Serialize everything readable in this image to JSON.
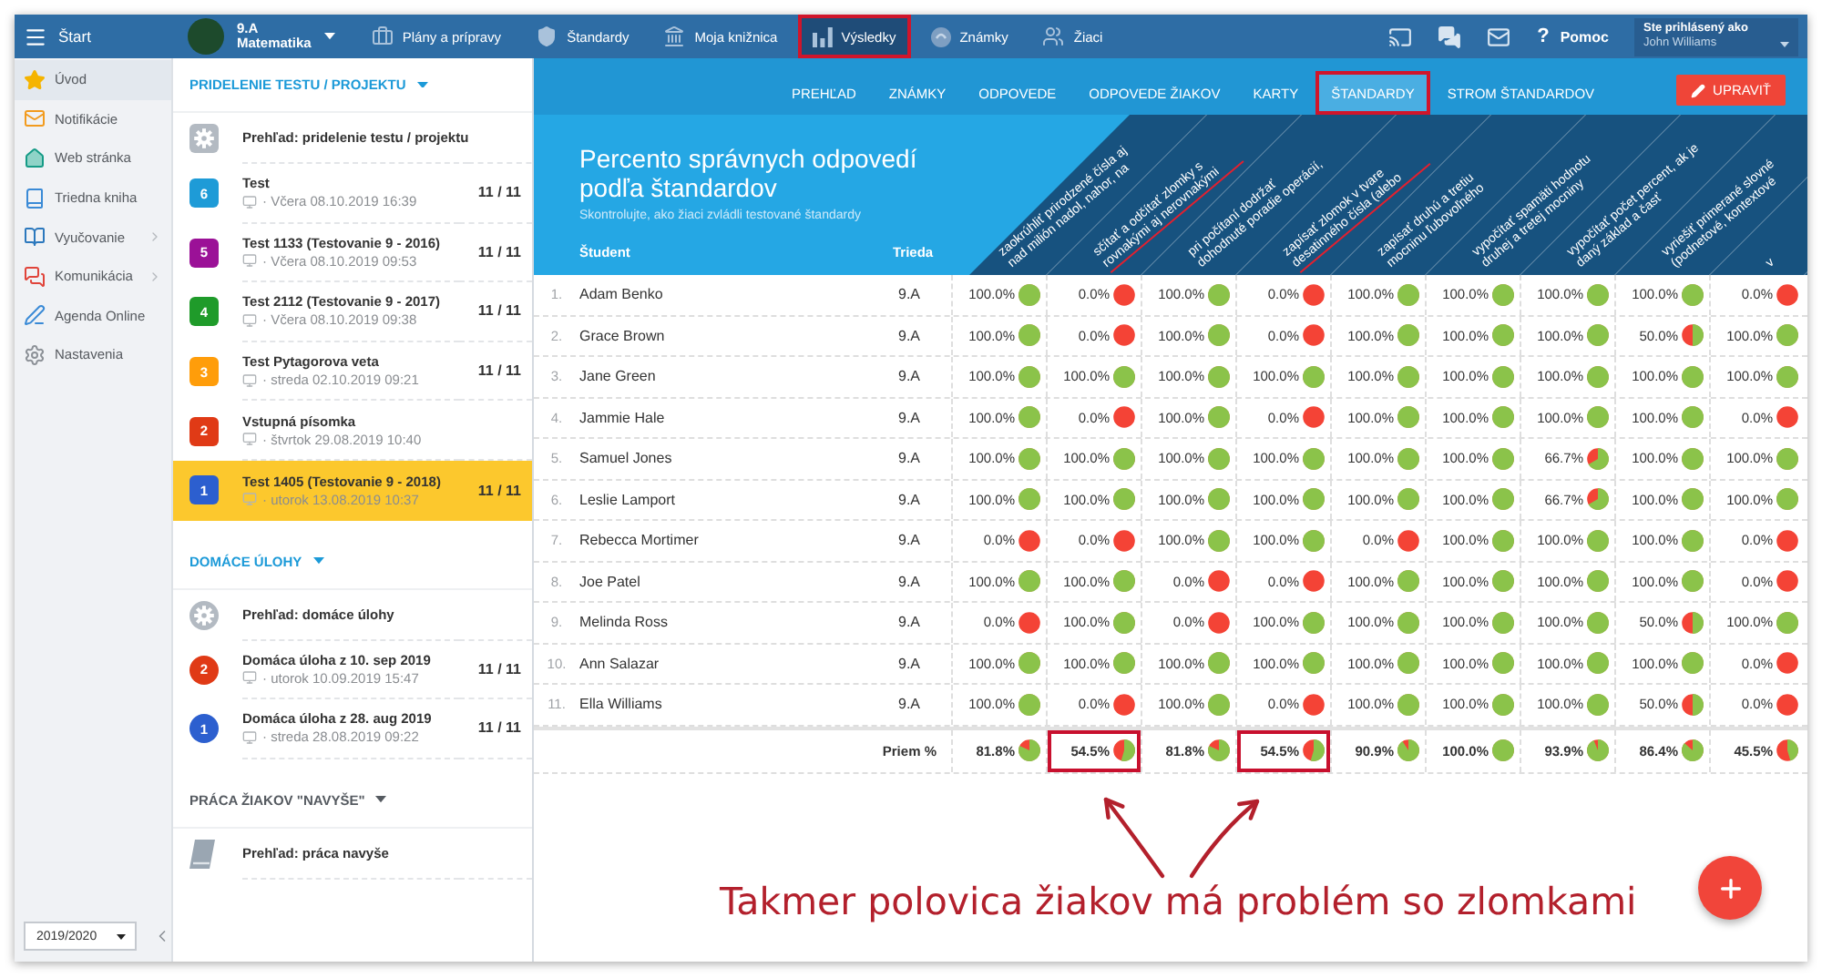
{
  "topbar": {
    "start": "Štart",
    "class_switcher": {
      "class": "9.A",
      "subject": "Matematika"
    },
    "nav": [
      {
        "label": "Plány a prípravy",
        "selected": false,
        "annotated": false
      },
      {
        "label": "Štandardy",
        "selected": false,
        "annotated": false
      },
      {
        "label": "Moja knižnica",
        "selected": false,
        "annotated": false
      },
      {
        "label": "Výsledky",
        "selected": true,
        "annotated": true
      },
      {
        "label": "Známky",
        "selected": false,
        "annotated": false
      },
      {
        "label": "Žiaci",
        "selected": false,
        "annotated": false
      }
    ],
    "help": {
      "glyph": "?",
      "label": "Pomoc"
    },
    "user": {
      "caption": "Ste prihlásený ako",
      "name": "John Williams"
    }
  },
  "sidebar": {
    "items": [
      {
        "label": "Úvod",
        "selected": true,
        "submenu": false
      },
      {
        "label": "Notifikácie",
        "selected": false,
        "submenu": false
      },
      {
        "label": "Web stránka",
        "selected": false,
        "submenu": false
      },
      {
        "label": "Triedna kniha",
        "selected": false,
        "submenu": false
      },
      {
        "label": "Vyučovanie",
        "selected": false,
        "submenu": true
      },
      {
        "label": "Komunikácia",
        "selected": false,
        "submenu": true
      },
      {
        "label": "Agenda Online",
        "selected": false,
        "submenu": false
      },
      {
        "label": "Nastavenia",
        "selected": false,
        "submenu": false
      }
    ],
    "year": "2019/2020"
  },
  "assignments": {
    "sections": [
      {
        "kind": "test",
        "title": "PRIDELENIE TESTU / PROJEKTU",
        "overview": "Prehľad: pridelenie testu / projektu",
        "items": [
          {
            "badge": "6",
            "color": "#1e9bd7",
            "title": "Test",
            "date": "· Včera 08.10.2019 16:39",
            "count": "11 / 11",
            "selected": false
          },
          {
            "badge": "5",
            "color": "#9b1197",
            "title": "Test 1133 (Testovanie 9 - 2016)",
            "date": "· Včera 08.10.2019 09:53",
            "count": "11 / 11",
            "selected": false
          },
          {
            "badge": "4",
            "color": "#1f9b2a",
            "title": "Test 2112 (Testovanie 9 - 2017)",
            "date": "· Včera 08.10.2019 09:38",
            "count": "11 / 11",
            "selected": false
          },
          {
            "badge": "3",
            "color": "#ff9d0a",
            "title": "Test Pytagorova veta",
            "date": "· streda 02.10.2019 09:21",
            "count": "11 / 11",
            "selected": false
          },
          {
            "badge": "2",
            "color": "#e03a16",
            "title": "Vstupná písomka",
            "date": "· štvrtok 29.08.2019 10:40",
            "selected": false
          },
          {
            "badge": "1",
            "color": "#2c5fcf",
            "title": "Test 1405 (Testovanie 9 - 2018)",
            "date": "· utorok 13.08.2019 10:37",
            "count": "11 / 11",
            "selected": true
          }
        ]
      },
      {
        "kind": "homework",
        "title": "DOMÁCE ÚLOHY",
        "overview": "Prehľad: domáce úlohy",
        "items": [
          {
            "badge": "2",
            "color": "#e03a16",
            "title": "Domáca úloha z 10. sep 2019",
            "date": "· utorok 10.09.2019 15:47",
            "count": "11 / 11",
            "selected": false
          },
          {
            "badge": "1",
            "color": "#2c5fcf",
            "title": "Domáca úloha z 28. aug 2019",
            "date": "· streda 28.08.2019 09:22",
            "count": "11 / 11",
            "selected": false
          }
        ]
      },
      {
        "kind": "extra",
        "title": "PRÁCA ŽIAKOV \"NAVYŠE\"",
        "overview": "Prehľad: práca navyše"
      }
    ]
  },
  "results": {
    "tabs": [
      {
        "label": "PREHĽAD",
        "selected": false,
        "annotated": false
      },
      {
        "label": "ZNÁMKY",
        "selected": false,
        "annotated": false
      },
      {
        "label": "ODPOVEDE",
        "selected": false,
        "annotated": false
      },
      {
        "label": "ODPOVEDE ŽIAKOV",
        "selected": false,
        "annotated": false
      },
      {
        "label": "KARTY",
        "selected": false,
        "annotated": false
      },
      {
        "label": "ŠTANDARDY",
        "selected": true,
        "annotated": true
      },
      {
        "label": "STROM ŠTANDARDOV",
        "selected": false,
        "annotated": false
      }
    ],
    "edit_button": "UPRAVIŤ",
    "title": "Percento správnych odpovedí podľa štandardov",
    "subtitle": "Skontrolujte, ako žiaci zvládli testované štandardy",
    "student_heading": "Študent",
    "class_heading": "Trieda",
    "standards": [
      {
        "label": "zaokrúhliť prirodzené čísla aj nad milión nadol, nahor, na",
        "annotated": false
      },
      {
        "label": "sčítať a odčítať zlomky s rovnakými aj nerovnakými",
        "annotated": true
      },
      {
        "label": "pri počítaní dodržať dohodnuté poradie operácií,",
        "annotated": false
      },
      {
        "label": "zapísať zlomok v tvare desatinného čísla (alebo",
        "annotated": true
      },
      {
        "label": "zapísať druhú a tretiu mocninu ľubovoľného",
        "annotated": false
      },
      {
        "label": "vypočítať spamäti hodnotu druhej a tretej mocniny",
        "annotated": false
      },
      {
        "label": "vypočítať počet percent, ak je daný základ a časť",
        "annotated": false
      },
      {
        "label": "vyriešiť primerané slovné (podnetové, kontextové",
        "annotated": false
      },
      {
        "label": "v",
        "annotated": false
      }
    ],
    "rows": [
      {
        "number": "1.",
        "name": "Adam Benko",
        "class": "9.A",
        "scores": [
          "100.0%",
          "0.0%",
          "100.0%",
          "0.0%",
          "100.0%",
          "100.0%",
          "100.0%",
          "100.0%",
          "0.0%"
        ]
      },
      {
        "number": "2.",
        "name": "Grace Brown",
        "class": "9.A",
        "scores": [
          "100.0%",
          "0.0%",
          "100.0%",
          "0.0%",
          "100.0%",
          "100.0%",
          "100.0%",
          "50.0%",
          "100.0%"
        ]
      },
      {
        "number": "3.",
        "name": "Jane Green",
        "class": "9.A",
        "scores": [
          "100.0%",
          "100.0%",
          "100.0%",
          "100.0%",
          "100.0%",
          "100.0%",
          "100.0%",
          "100.0%",
          "100.0%"
        ]
      },
      {
        "number": "4.",
        "name": "Jammie Hale",
        "class": "9.A",
        "scores": [
          "100.0%",
          "0.0%",
          "100.0%",
          "0.0%",
          "100.0%",
          "100.0%",
          "100.0%",
          "100.0%",
          "0.0%"
        ]
      },
      {
        "number": "5.",
        "name": "Samuel Jones",
        "class": "9.A",
        "scores": [
          "100.0%",
          "100.0%",
          "100.0%",
          "100.0%",
          "100.0%",
          "100.0%",
          "66.7%",
          "100.0%",
          "100.0%"
        ]
      },
      {
        "number": "6.",
        "name": "Leslie Lamport",
        "class": "9.A",
        "scores": [
          "100.0%",
          "100.0%",
          "100.0%",
          "100.0%",
          "100.0%",
          "100.0%",
          "66.7%",
          "100.0%",
          "100.0%"
        ]
      },
      {
        "number": "7.",
        "name": "Rebecca Mortimer",
        "class": "9.A",
        "scores": [
          "0.0%",
          "0.0%",
          "100.0%",
          "100.0%",
          "0.0%",
          "100.0%",
          "100.0%",
          "100.0%",
          "0.0%"
        ]
      },
      {
        "number": "8.",
        "name": "Joe Patel",
        "class": "9.A",
        "scores": [
          "100.0%",
          "100.0%",
          "0.0%",
          "0.0%",
          "100.0%",
          "100.0%",
          "100.0%",
          "100.0%",
          "0.0%"
        ]
      },
      {
        "number": "9.",
        "name": "Melinda Ross",
        "class": "9.A",
        "scores": [
          "0.0%",
          "100.0%",
          "0.0%",
          "100.0%",
          "100.0%",
          "100.0%",
          "100.0%",
          "50.0%",
          "100.0%"
        ]
      },
      {
        "number": "10.",
        "name": "Ann Salazar",
        "class": "9.A",
        "scores": [
          "100.0%",
          "100.0%",
          "100.0%",
          "100.0%",
          "100.0%",
          "100.0%",
          "100.0%",
          "100.0%",
          "0.0%"
        ]
      },
      {
        "number": "11.",
        "name": "Ella Williams",
        "class": "9.A",
        "scores": [
          "100.0%",
          "0.0%",
          "100.0%",
          "0.0%",
          "100.0%",
          "100.0%",
          "100.0%",
          "50.0%",
          "0.0%"
        ]
      }
    ],
    "average": {
      "label": "Priem %",
      "values": [
        {
          "text": "81.8%",
          "annotated": false
        },
        {
          "text": "54.5%",
          "annotated": true
        },
        {
          "text": "81.8%",
          "annotated": false
        },
        {
          "text": "54.5%",
          "annotated": true
        },
        {
          "text": "90.9%",
          "annotated": false
        },
        {
          "text": "100.0%",
          "annotated": false
        },
        {
          "text": "93.9%",
          "annotated": false
        },
        {
          "text": "86.4%",
          "annotated": false
        },
        {
          "text": "45.5%",
          "annotated": false
        }
      ]
    }
  },
  "annotation": {
    "text": "Takmer polovica žiakov má problém so zlomkami"
  }
}
